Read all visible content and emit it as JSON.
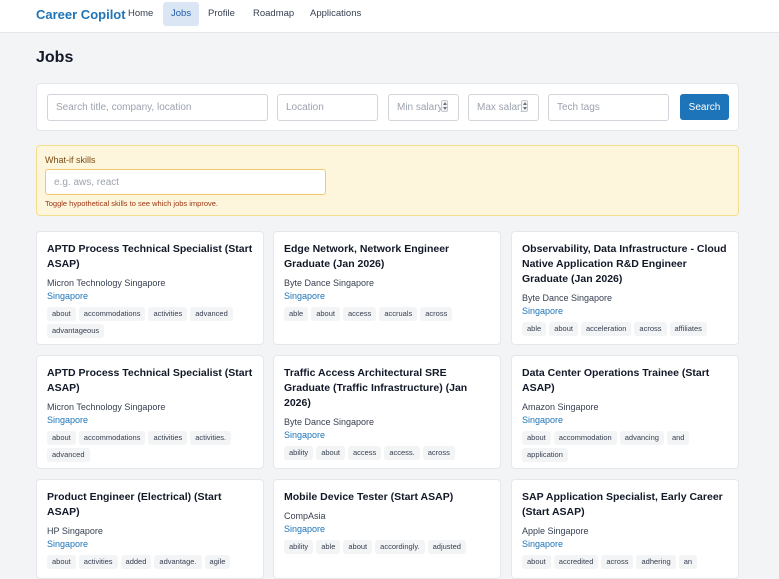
{
  "nav": {
    "brand": "Career Copilot",
    "items": [
      {
        "label": "Home",
        "active": false
      },
      {
        "label": "Jobs",
        "active": true
      },
      {
        "label": "Profile",
        "active": false
      },
      {
        "label": "Roadmap",
        "active": false
      },
      {
        "label": "Applications",
        "active": false
      }
    ]
  },
  "page": {
    "title": "Jobs"
  },
  "search": {
    "query_placeholder": "Search title, company, location",
    "location_placeholder": "Location",
    "min_salary_placeholder": "Min salary",
    "max_salary_placeholder": "Max salary",
    "tech_tags_placeholder": "Tech tags",
    "button_label": "Search"
  },
  "whatif": {
    "label": "What-if skills",
    "placeholder": "e.g. aws, react",
    "hint": "Toggle hypothetical skills to see which jobs improve."
  },
  "jobs": [
    {
      "title": "APTD Process Technical Specialist (Start ASAP)",
      "company": "Micron Technology Singapore",
      "location": "Singapore",
      "tags": [
        "about",
        "accommodations",
        "activities",
        "advanced",
        "advantageous"
      ]
    },
    {
      "title": "Edge Network, Network Engineer Graduate (Jan 2026)",
      "company": "Byte Dance Singapore",
      "location": "Singapore",
      "tags": [
        "able",
        "about",
        "access",
        "accruals",
        "across"
      ]
    },
    {
      "title": "Observability, Data Infrastructure - Cloud Native Application R&D Engineer Graduate (Jan 2026)",
      "company": "Byte Dance Singapore",
      "location": "Singapore",
      "tags": [
        "able",
        "about",
        "acceleration",
        "across",
        "affiliates"
      ]
    },
    {
      "title": "APTD Process Technical Specialist (Start ASAP)",
      "company": "Micron Technology Singapore",
      "location": "Singapore",
      "tags": [
        "about",
        "accommodations",
        "activities",
        "activities.",
        "advanced"
      ]
    },
    {
      "title": "Traffic Access Architectural SRE Graduate (Traffic Infrastructure) (Jan 2026)",
      "company": "Byte Dance Singapore",
      "location": "Singapore",
      "tags": [
        "ability",
        "about",
        "access",
        "access.",
        "across"
      ]
    },
    {
      "title": "Data Center Operations Trainee (Start ASAP)",
      "company": "Amazon Singapore",
      "location": "Singapore",
      "tags": [
        "about",
        "accommodation",
        "advancing",
        "and",
        "application"
      ]
    },
    {
      "title": "Product Engineer (Electrical) (Start ASAP)",
      "company": "HP Singapore",
      "location": "Singapore",
      "tags": [
        "about",
        "activities",
        "added",
        "advantage.",
        "agile"
      ]
    },
    {
      "title": "Mobile Device Tester (Start ASAP)",
      "company": "CompAsia",
      "location": "Singapore",
      "tags": [
        "ability",
        "able",
        "about",
        "accordingly.",
        "adjusted"
      ]
    },
    {
      "title": "SAP Application Specialist, Early Career (Start ASAP)",
      "company": "Apple Singapore",
      "location": "Singapore",
      "tags": [
        "about",
        "accredited",
        "across",
        "adhering",
        "an"
      ]
    }
  ]
}
